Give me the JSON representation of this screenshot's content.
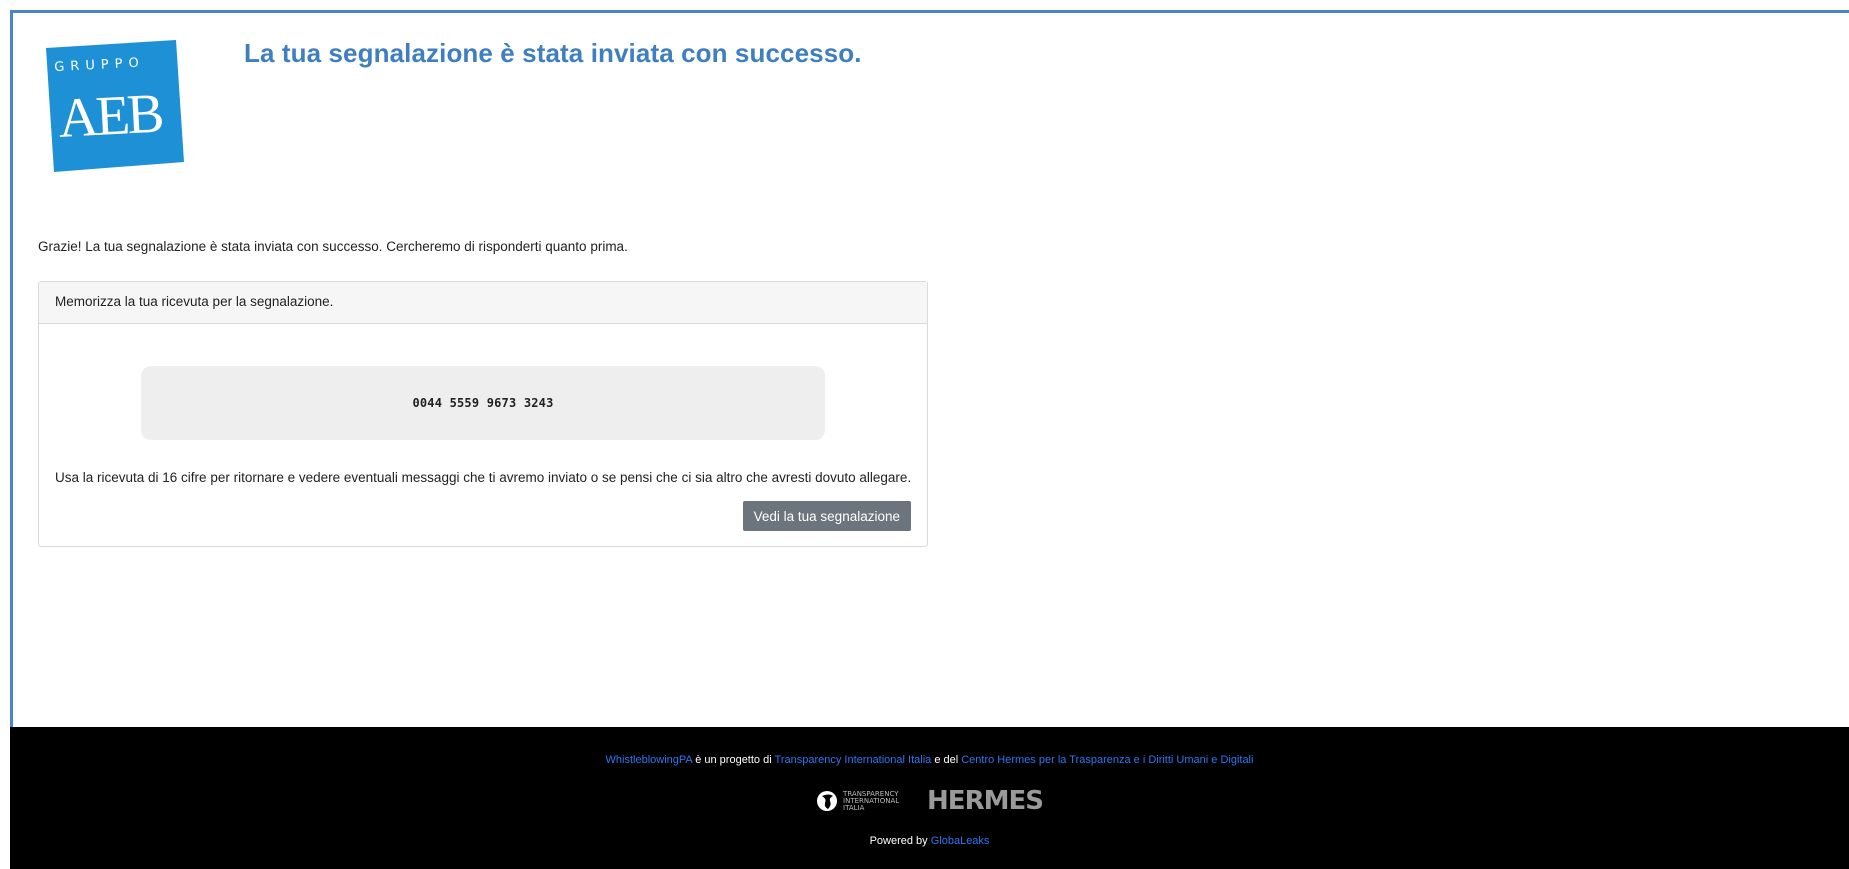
{
  "header": {
    "logo_top_text": "GRUPPO",
    "logo_main_text": "AEB",
    "title": "La tua segnalazione è stata inviata con successo."
  },
  "content": {
    "thanks_message": "Grazie! La tua segnalazione è stata inviata con successo. Cercheremo di risponderti quanto prima.",
    "panel": {
      "header": "Memorizza la tua ricevuta per la segnalazione.",
      "receipt_code": "0044 5559 9673 3243",
      "instructions": "Usa la ricevuta di 16 cifre per ritornare e vedere eventuali messaggi che ti avremo inviato o se pensi che ci sia altro che avresti dovuto allegare.",
      "view_button": "Vedi la tua segnalazione"
    }
  },
  "footer": {
    "link_whistleblowing": "WhistleblowingPA",
    "text_project_of": " è un progetto di ",
    "link_transparency": "Transparency International Italia",
    "text_and": " e del ",
    "link_hermes": "Centro Hermes per la Trasparenza e i Diritti Umani e Digitali",
    "ti_logo_text": "TRANSPARENCY INTERNATIONAL ITALIA",
    "hermes_logo_text": "HERMES",
    "powered_by": "Powered by ",
    "link_globaleaks": "GlobaLeaks"
  },
  "colors": {
    "accent": "#3f7fbf",
    "logo_blue": "#1e91d6",
    "button_gray": "#6c757d",
    "footer_bg": "#000000",
    "footer_link": "#2b76f5"
  }
}
